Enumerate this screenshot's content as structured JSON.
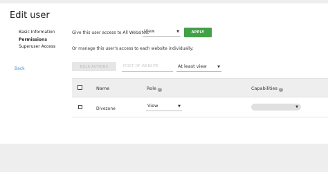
{
  "page": {
    "title": "Edit user"
  },
  "sidebar": {
    "items": [
      {
        "label": "Basic Information",
        "active": false
      },
      {
        "label": "Permissions",
        "active": true
      },
      {
        "label": "Superuser Access",
        "active": false
      }
    ],
    "back_label": "Back"
  },
  "permissions": {
    "all_websites_label": "Give this user access to All Websites:",
    "all_websites_value": "View",
    "apply_label": "APPLY",
    "individual_label": "Or manage this user's access to each website individually:",
    "bulk_actions_label": "BULK ACTIONS",
    "filter_placeholder": "FIRST OF WEBSITE",
    "access_filter_value": "At least view"
  },
  "table": {
    "columns": [
      "Name",
      "Role",
      "Capabilities"
    ],
    "rows": [
      {
        "name": "Divezone",
        "role": "View",
        "capabilities": ""
      }
    ]
  },
  "colors": {
    "apply_button": "#43a047",
    "link": "#3b8fd6"
  }
}
